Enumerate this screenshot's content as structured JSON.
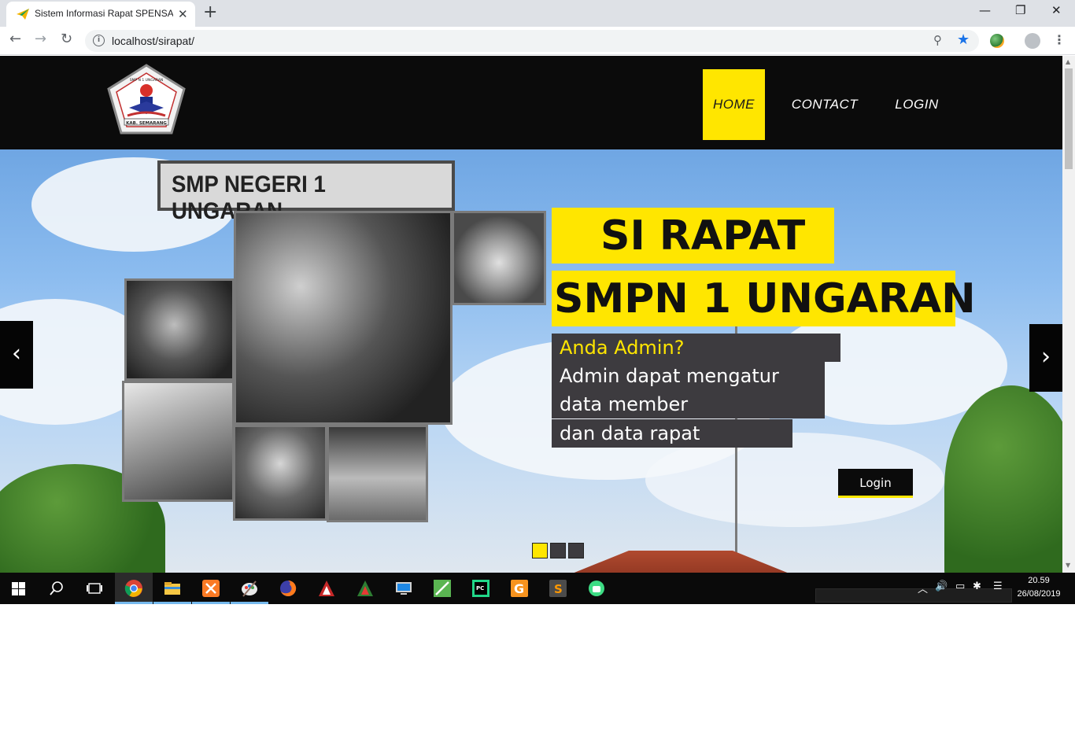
{
  "browser": {
    "tab_title": "Sistem Informasi Rapat SPENSA |",
    "tab_close": "✕",
    "new_tab": "+",
    "url": "localhost/sirapat/",
    "window_controls": {
      "minimize": "—",
      "restore": "❐",
      "close": "✕"
    },
    "nav": {
      "back": "←",
      "forward": "→",
      "reload": "↻"
    },
    "icons": [
      "info-icon",
      "zoom-icon",
      "bookmark-star-icon",
      "extension-icon",
      "profile-icon",
      "menu-icon"
    ]
  },
  "site": {
    "logo_alt": "SMP N 1 Ungaran logo",
    "logo_text_top": "SMP N 1 UNGARAN",
    "logo_text_bottom": "KAB. SEMARANG",
    "menu": [
      {
        "label": "HOME",
        "active": true
      },
      {
        "label": "CONTACT",
        "active": false
      },
      {
        "label": "LOGIN",
        "active": false
      }
    ]
  },
  "hero": {
    "sign_text": "SMP NEGERI 1 UNGARAN",
    "title_line1": "SI RAPAT",
    "title_line2": "SMPN 1 UNGARAN",
    "question": "Anda Admin?",
    "desc_lines": [
      "Admin dapat mengatur",
      "data member",
      "dan data rapat"
    ],
    "login_button": "Login",
    "prev_arrow": "‹",
    "next_arrow": "›",
    "slides": 3,
    "active_slide": 1,
    "accent_color": "#ffe600",
    "dark_box_color": "#3d3b3f"
  },
  "taskbar": {
    "apps": [
      "chrome",
      "file-explorer",
      "xampp",
      "paint",
      "firefox",
      "app-1",
      "app-2",
      "remote-desktop",
      "android-studio",
      "pycharm",
      "gitkraken",
      "sublime-text",
      "android-app"
    ],
    "time": "20.59",
    "date": "26/08/2019"
  }
}
